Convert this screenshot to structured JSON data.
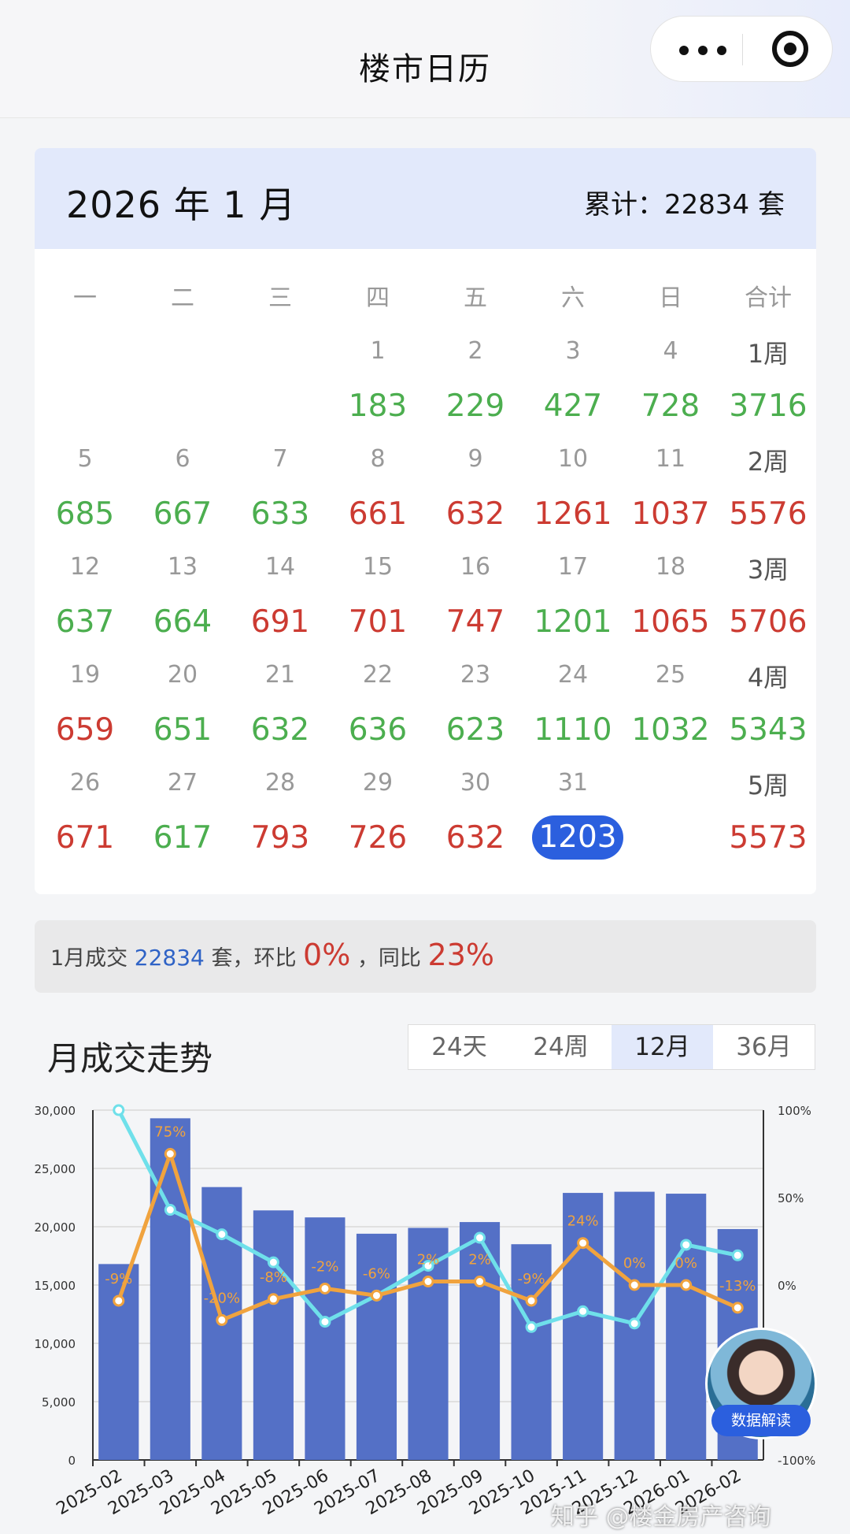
{
  "app": {
    "title": "楼市日历"
  },
  "calendar": {
    "month_title": "2026 年 1 月",
    "total_label": "累计：22834 套",
    "weekday_headers": [
      "一",
      "二",
      "三",
      "四",
      "五",
      "六",
      "日",
      "合计"
    ],
    "weeks": [
      {
        "label": "1周",
        "days": [
          null,
          null,
          null,
          "1",
          "2",
          "3",
          "4"
        ],
        "values": [
          null,
          null,
          null,
          "183",
          "229",
          "427",
          "728"
        ],
        "colors": [
          null,
          null,
          null,
          "green",
          "green",
          "green",
          "green"
        ],
        "total": "3716",
        "total_color": "green"
      },
      {
        "label": "2周",
        "days": [
          "5",
          "6",
          "7",
          "8",
          "9",
          "10",
          "11"
        ],
        "values": [
          "685",
          "667",
          "633",
          "661",
          "632",
          "1261",
          "1037"
        ],
        "colors": [
          "green",
          "green",
          "green",
          "red",
          "red",
          "red",
          "red"
        ],
        "total": "5576",
        "total_color": "red"
      },
      {
        "label": "3周",
        "days": [
          "12",
          "13",
          "14",
          "15",
          "16",
          "17",
          "18"
        ],
        "values": [
          "637",
          "664",
          "691",
          "701",
          "747",
          "1201",
          "1065"
        ],
        "colors": [
          "green",
          "green",
          "red",
          "red",
          "red",
          "green",
          "red"
        ],
        "total": "5706",
        "total_color": "red"
      },
      {
        "label": "4周",
        "days": [
          "19",
          "20",
          "21",
          "22",
          "23",
          "24",
          "25"
        ],
        "values": [
          "659",
          "651",
          "632",
          "636",
          "623",
          "1110",
          "1032"
        ],
        "colors": [
          "red",
          "green",
          "green",
          "green",
          "green",
          "green",
          "green"
        ],
        "total": "5343",
        "total_color": "green"
      },
      {
        "label": "5周",
        "days": [
          "26",
          "27",
          "28",
          "29",
          "30",
          "31",
          null
        ],
        "values": [
          "671",
          "617",
          "793",
          "726",
          "632",
          "1203",
          null
        ],
        "colors": [
          "red",
          "green",
          "red",
          "red",
          "red",
          "selected",
          null
        ],
        "total": "5573",
        "total_color": "red"
      }
    ]
  },
  "summary": {
    "prefix": "1月成交",
    "amount": "22834",
    "mid": "套，环比",
    "mom": "0%",
    "sep": "，同比",
    "yoy": "23%"
  },
  "trend": {
    "title": "月成交走势",
    "tabs": [
      {
        "label": "24天",
        "active": false
      },
      {
        "label": "24周",
        "active": false
      },
      {
        "label": "12月",
        "active": true
      },
      {
        "label": "36月",
        "active": false
      }
    ]
  },
  "chart_data": {
    "type": "bar",
    "categories": [
      "2025-02",
      "2025-03",
      "2025-04",
      "2025-05",
      "2025-06",
      "2025-07",
      "2025-08",
      "2025-09",
      "2025-10",
      "2025-11",
      "2025-12",
      "2026-01",
      "2026-02"
    ],
    "series": [
      {
        "name": "",
        "type": "bar",
        "color": "#5470c6",
        "values": [
          16800,
          29300,
          23400,
          21400,
          20800,
          19400,
          19900,
          20400,
          18500,
          22900,
          23000,
          22834,
          19800
        ]
      },
      {
        "name": "",
        "type": "line",
        "axis": "right",
        "color": "#f0a33e",
        "values": [
          -9,
          75,
          -20,
          -8,
          -2,
          -6,
          2,
          2,
          -9,
          24,
          0,
          0,
          -13
        ],
        "labels": [
          "-9%",
          "75%",
          "-20%",
          "-8%",
          "-2%",
          "-6%",
          "2%",
          "2%",
          "-9%",
          "24%",
          "0%",
          "0%",
          "-13%"
        ]
      },
      {
        "name": "",
        "type": "line",
        "axis": "right",
        "color": "#6fe0ea",
        "values": [
          100,
          43,
          29,
          13,
          -21,
          -6,
          11,
          27,
          -24,
          -15,
          -22,
          23,
          17
        ]
      }
    ],
    "ylim": [
      0,
      30000
    ],
    "y_ticks": [
      "0",
      "5,000",
      "10,000",
      "15,000",
      "20,000",
      "25,000",
      "30,000"
    ],
    "y2lim": [
      -100,
      100
    ],
    "y2_ticks": [
      "-100%",
      "0%",
      "50%",
      "100%"
    ],
    "grid": true
  },
  "widget": {
    "label": "数据解读"
  },
  "watermark": "知乎 @楼金房产咨询"
}
